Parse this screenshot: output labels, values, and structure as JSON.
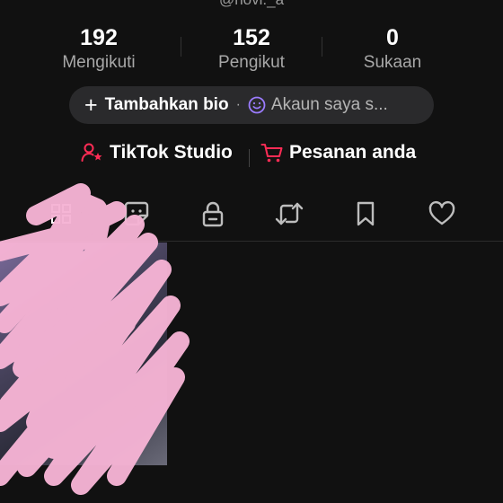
{
  "profile": {
    "handle": "@novi._a"
  },
  "stats": [
    {
      "value": "192",
      "label": "Mengikuti"
    },
    {
      "value": "152",
      "label": "Pengikut"
    },
    {
      "value": "0",
      "label": "Sukaan"
    }
  ],
  "bio_bar": {
    "add_bio_label": "Tambahkan bio",
    "separator": "·",
    "account_label": "Akaun saya s..."
  },
  "links": {
    "studio_label": "TikTok Studio",
    "orders_label": "Pesanan anda"
  },
  "tabs": [
    {
      "icon": "grid-icon"
    },
    {
      "icon": "sticker-icon"
    },
    {
      "icon": "lock-icon"
    },
    {
      "icon": "repost-icon"
    },
    {
      "icon": "bookmark-icon"
    },
    {
      "icon": "heart-icon"
    }
  ],
  "colors": {
    "background": "#111111",
    "bio_bar": "#2a2a2c",
    "accent_red": "#fe2c55",
    "account_icon": "#9b7cff",
    "redaction": "#f5b3d4"
  }
}
